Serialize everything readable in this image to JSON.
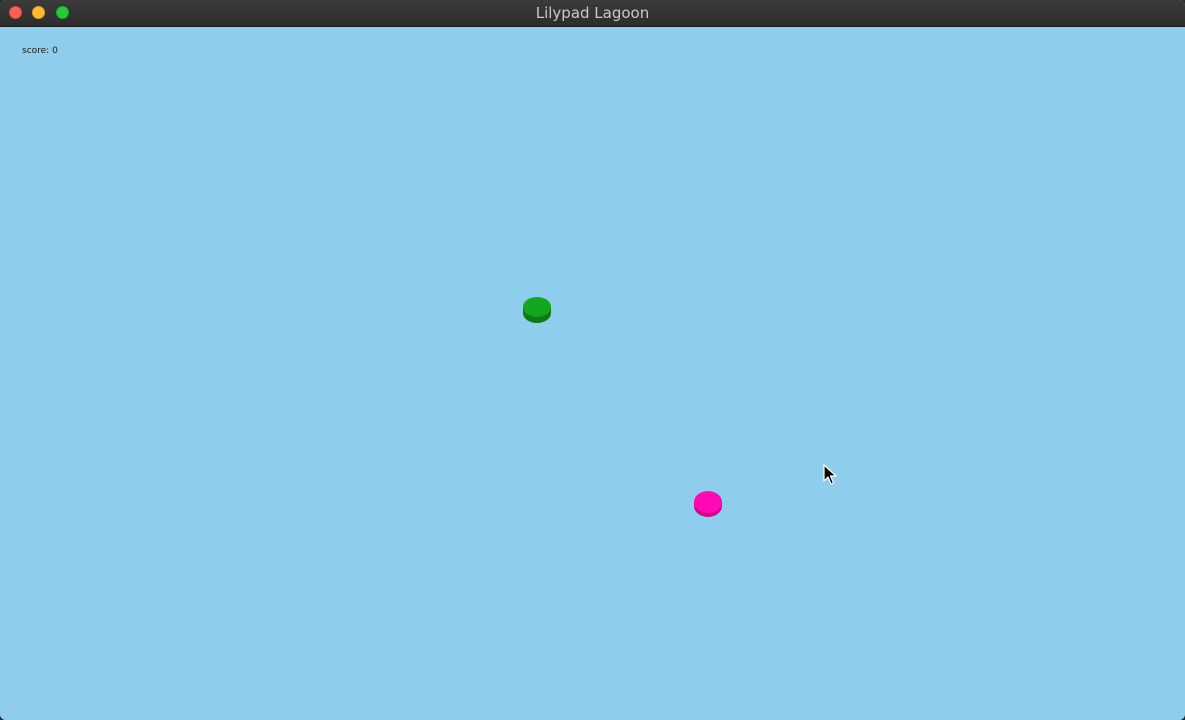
{
  "window": {
    "title": "Lilypad Lagoon"
  },
  "hud": {
    "score_text": "score: 0"
  },
  "entities": {
    "lilypad": {
      "color": "#13a51c",
      "shade": "#0d7a14"
    },
    "player": {
      "color": "#ff0ab4",
      "shade": "#d6008f"
    }
  },
  "colors": {
    "water": "#8fcdec",
    "titlebar": "#2d2d2d"
  }
}
